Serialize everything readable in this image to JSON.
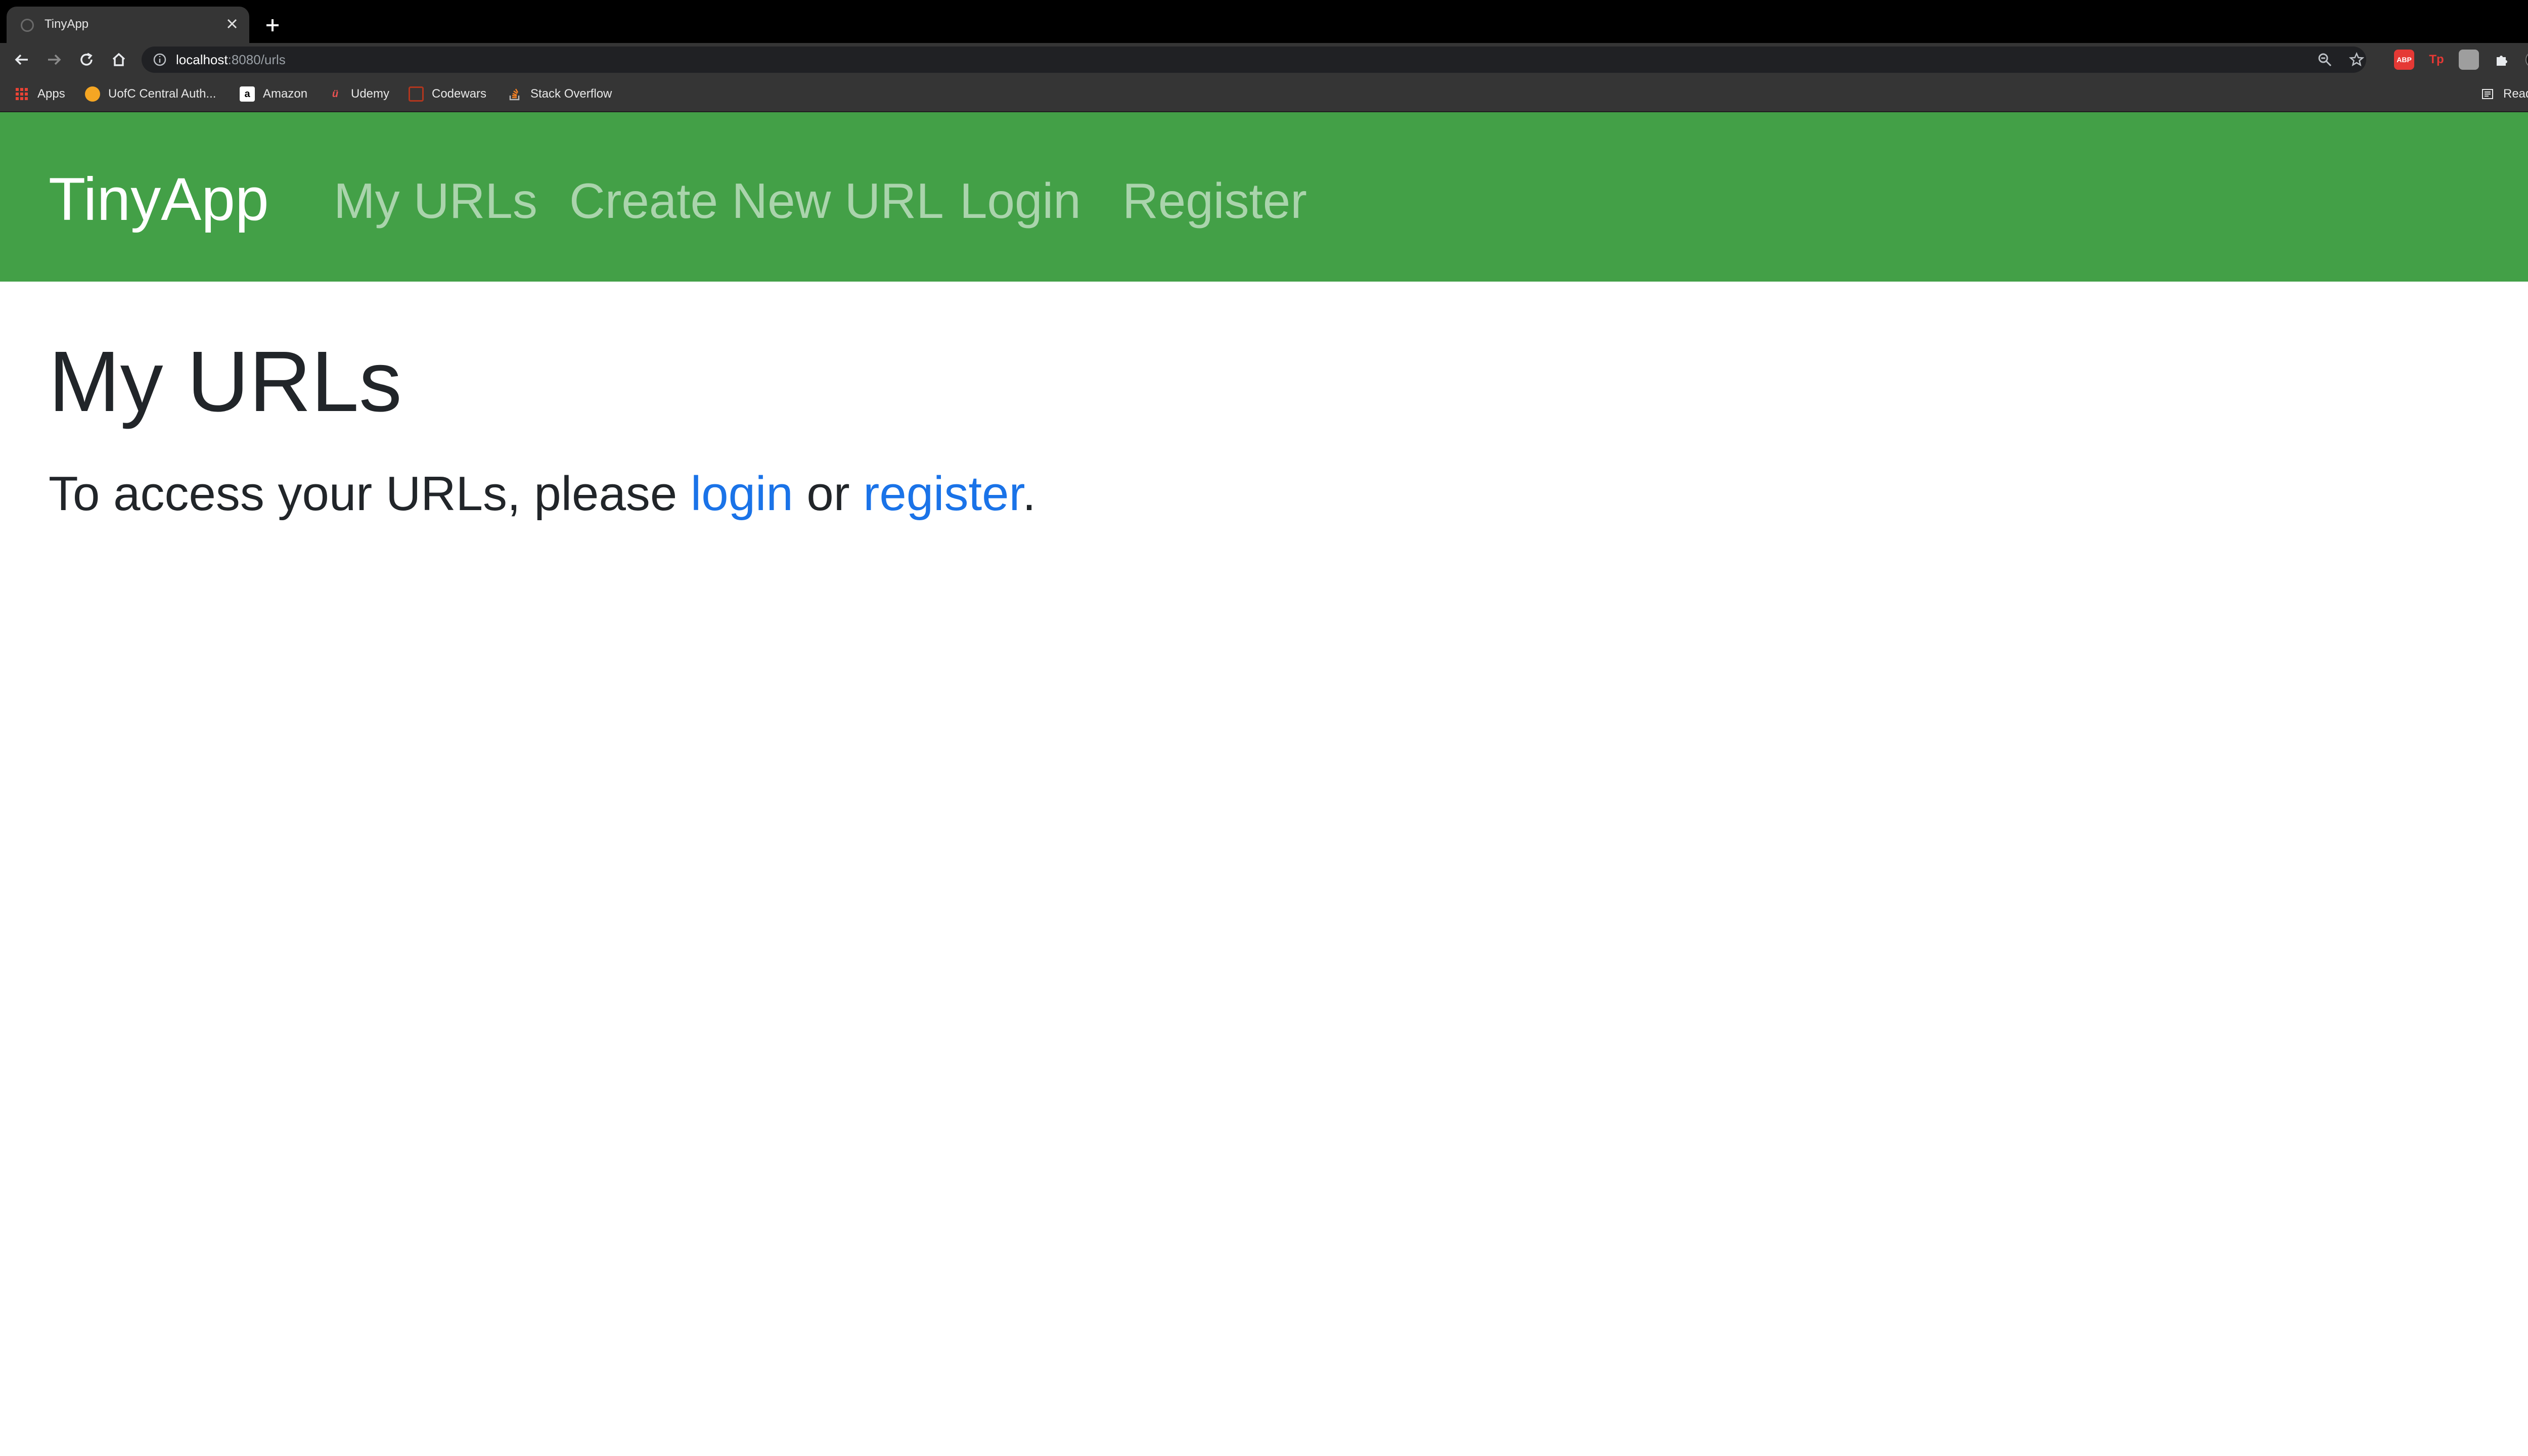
{
  "browser": {
    "tab": {
      "title": "TinyApp"
    },
    "address": {
      "host": "localhost",
      "rest": ":8080/urls"
    },
    "extensions": [
      {
        "name": "adblock-extension-icon",
        "label": "ABP",
        "color": "#e53935"
      },
      {
        "name": "tp-extension-icon",
        "label": "Tp",
        "color": "#d32f2f"
      },
      {
        "name": "generic-extension-icon",
        "label": "",
        "color": "#9e9e9e"
      }
    ],
    "bookmarks": [
      {
        "label": "Apps",
        "icon": "apps-grid-icon"
      },
      {
        "label": "UofC Central Auth...",
        "icon": "dinosaur-icon"
      },
      {
        "label": "Amazon",
        "icon": "amazon-icon"
      },
      {
        "label": "Udemy",
        "icon": "udemy-icon"
      },
      {
        "label": "Codewars",
        "icon": "codewars-icon"
      },
      {
        "label": "Stack Overflow",
        "icon": "stackoverflow-icon"
      }
    ],
    "reading_list": "Reading List"
  },
  "nav": {
    "brand": "TinyApp",
    "links": [
      "My URLs",
      "Create New URL",
      "Login",
      "Register"
    ]
  },
  "main": {
    "title": "My URLs",
    "message_prefix": "To access your URLs, please ",
    "login_link": "login",
    "message_middle": " or ",
    "register_link": "register",
    "message_suffix": "."
  },
  "colors": {
    "navbar": "#43a047",
    "link": "#1a73e8",
    "text": "#212529"
  }
}
